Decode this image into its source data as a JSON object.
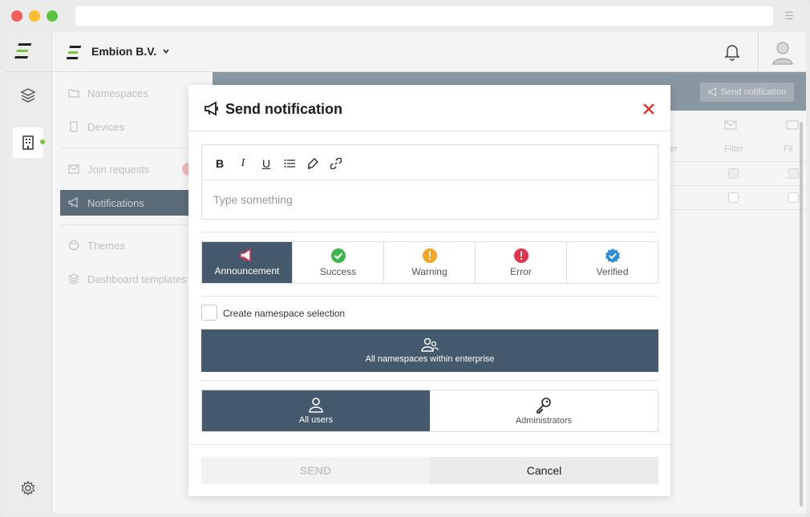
{
  "window": {
    "controls": [
      "close",
      "minimize",
      "maximize"
    ],
    "colors": {
      "close": "#f25f58",
      "minimize": "#fbbe2f",
      "maximize": "#59c33f"
    }
  },
  "header": {
    "company": "Embion B.V.",
    "bell_icon": "bell-icon",
    "avatar_icon": "avatar-icon"
  },
  "rail": {
    "items": [
      {
        "icon": "layers-icon"
      },
      {
        "icon": "building-icon",
        "status_color": "#7cc13c"
      }
    ],
    "settings_icon": "gear-icon"
  },
  "sidebar": {
    "items": [
      {
        "label": "Namespaces",
        "icon": "folder-icon"
      },
      {
        "label": "Devices",
        "icon": "device-icon"
      },
      {
        "label": "Join requests",
        "icon": "mail-icon"
      },
      {
        "label": "Notifications",
        "icon": "megaphone-icon",
        "active": true
      },
      {
        "label": "Themes",
        "icon": "palette-icon"
      },
      {
        "label": "Dashboard templates",
        "icon": "layers-icon"
      }
    ]
  },
  "content": {
    "send_button": "Send notification",
    "columns": [
      {
        "label": "er"
      },
      {
        "label": "Filter"
      },
      {
        "label": "Fil"
      }
    ]
  },
  "modal": {
    "title": "Send notification",
    "title_icon": "megaphone-icon",
    "close_icon": "close-icon",
    "toolbar": [
      {
        "name": "bold",
        "label": "B"
      },
      {
        "name": "italic",
        "label": "I"
      },
      {
        "name": "underline",
        "label": "U"
      },
      {
        "name": "list",
        "icon": "list-icon"
      },
      {
        "name": "highlight",
        "icon": "pen-icon"
      },
      {
        "name": "link",
        "icon": "link-icon"
      }
    ],
    "editor_placeholder": "Type something",
    "types": [
      {
        "label": "Announcement",
        "icon": "megaphone-icon",
        "active": true
      },
      {
        "label": "Success",
        "icon": "check-circle-icon",
        "color": "#3cb54a"
      },
      {
        "label": "Warning",
        "icon": "exclamation-circle-icon",
        "color": "#f4a425"
      },
      {
        "label": "Error",
        "icon": "exclamation-circle-icon",
        "color": "#e5334b"
      },
      {
        "label": "Verified",
        "icon": "verified-badge-icon",
        "color": "#2f8fd8"
      }
    ],
    "namespace_checkbox": "Create namespace selection",
    "namespace_button": "All namespaces within enterprise",
    "recipients": [
      {
        "label": "All users",
        "icon": "user-icon",
        "active": true
      },
      {
        "label": "Administrators",
        "icon": "key-icon"
      }
    ],
    "send": "SEND",
    "cancel": "Cancel"
  },
  "colors": {
    "accent": "#44596b",
    "close": "#e5322d"
  }
}
